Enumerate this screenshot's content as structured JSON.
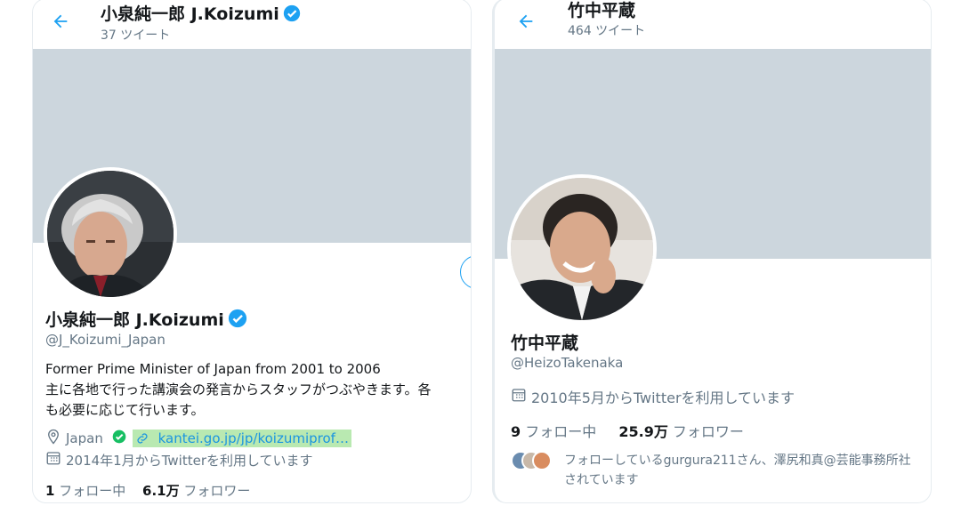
{
  "colors": {
    "accent": "#1da1f2",
    "banner": "#ccd6dd",
    "muted": "#657786",
    "link_highlight": "#b9e9b1"
  },
  "left": {
    "topbar_name": "小泉純一郎 J.Koizumi",
    "topbar_count": "37 ツイート",
    "name": "小泉純一郎 J.Koizumi",
    "handle": "@J_Koizumi_Japan",
    "bio_line1": "Former Prime Minister of Japan from 2001 to 2006",
    "bio_line2": "主に各地で行った講演会の発言からスタッフがつぶやきます。各",
    "bio_line3": "も必要に応じて行います。",
    "location": "Japan",
    "website": "kantei.go.jp/jp/koizumiprof…",
    "joined": "2014年1月からTwitterを利用しています",
    "following_count": "1",
    "following_label": "フォロー中",
    "followers_count": "6.1万",
    "followers_label": "フォロワー"
  },
  "right": {
    "topbar_name": "竹中平蔵",
    "topbar_count": "464 ツイート",
    "name": "竹中平蔵",
    "handle": "@HeizoTakenaka",
    "joined": "2010年5月からTwitterを利用しています",
    "following_count": "9",
    "following_label": "フォロー中",
    "followers_count": "25.9万",
    "followers_label": "フォロワー",
    "followed_by_line1": "フォローしているgurgura211さん、澤尻和真@芸能事務所社",
    "followed_by_line2": "されています"
  },
  "icons": [
    "back-arrow-icon",
    "verified-badge-icon",
    "location-pin-icon",
    "link-icon",
    "calendar-icon",
    "check-icon"
  ]
}
